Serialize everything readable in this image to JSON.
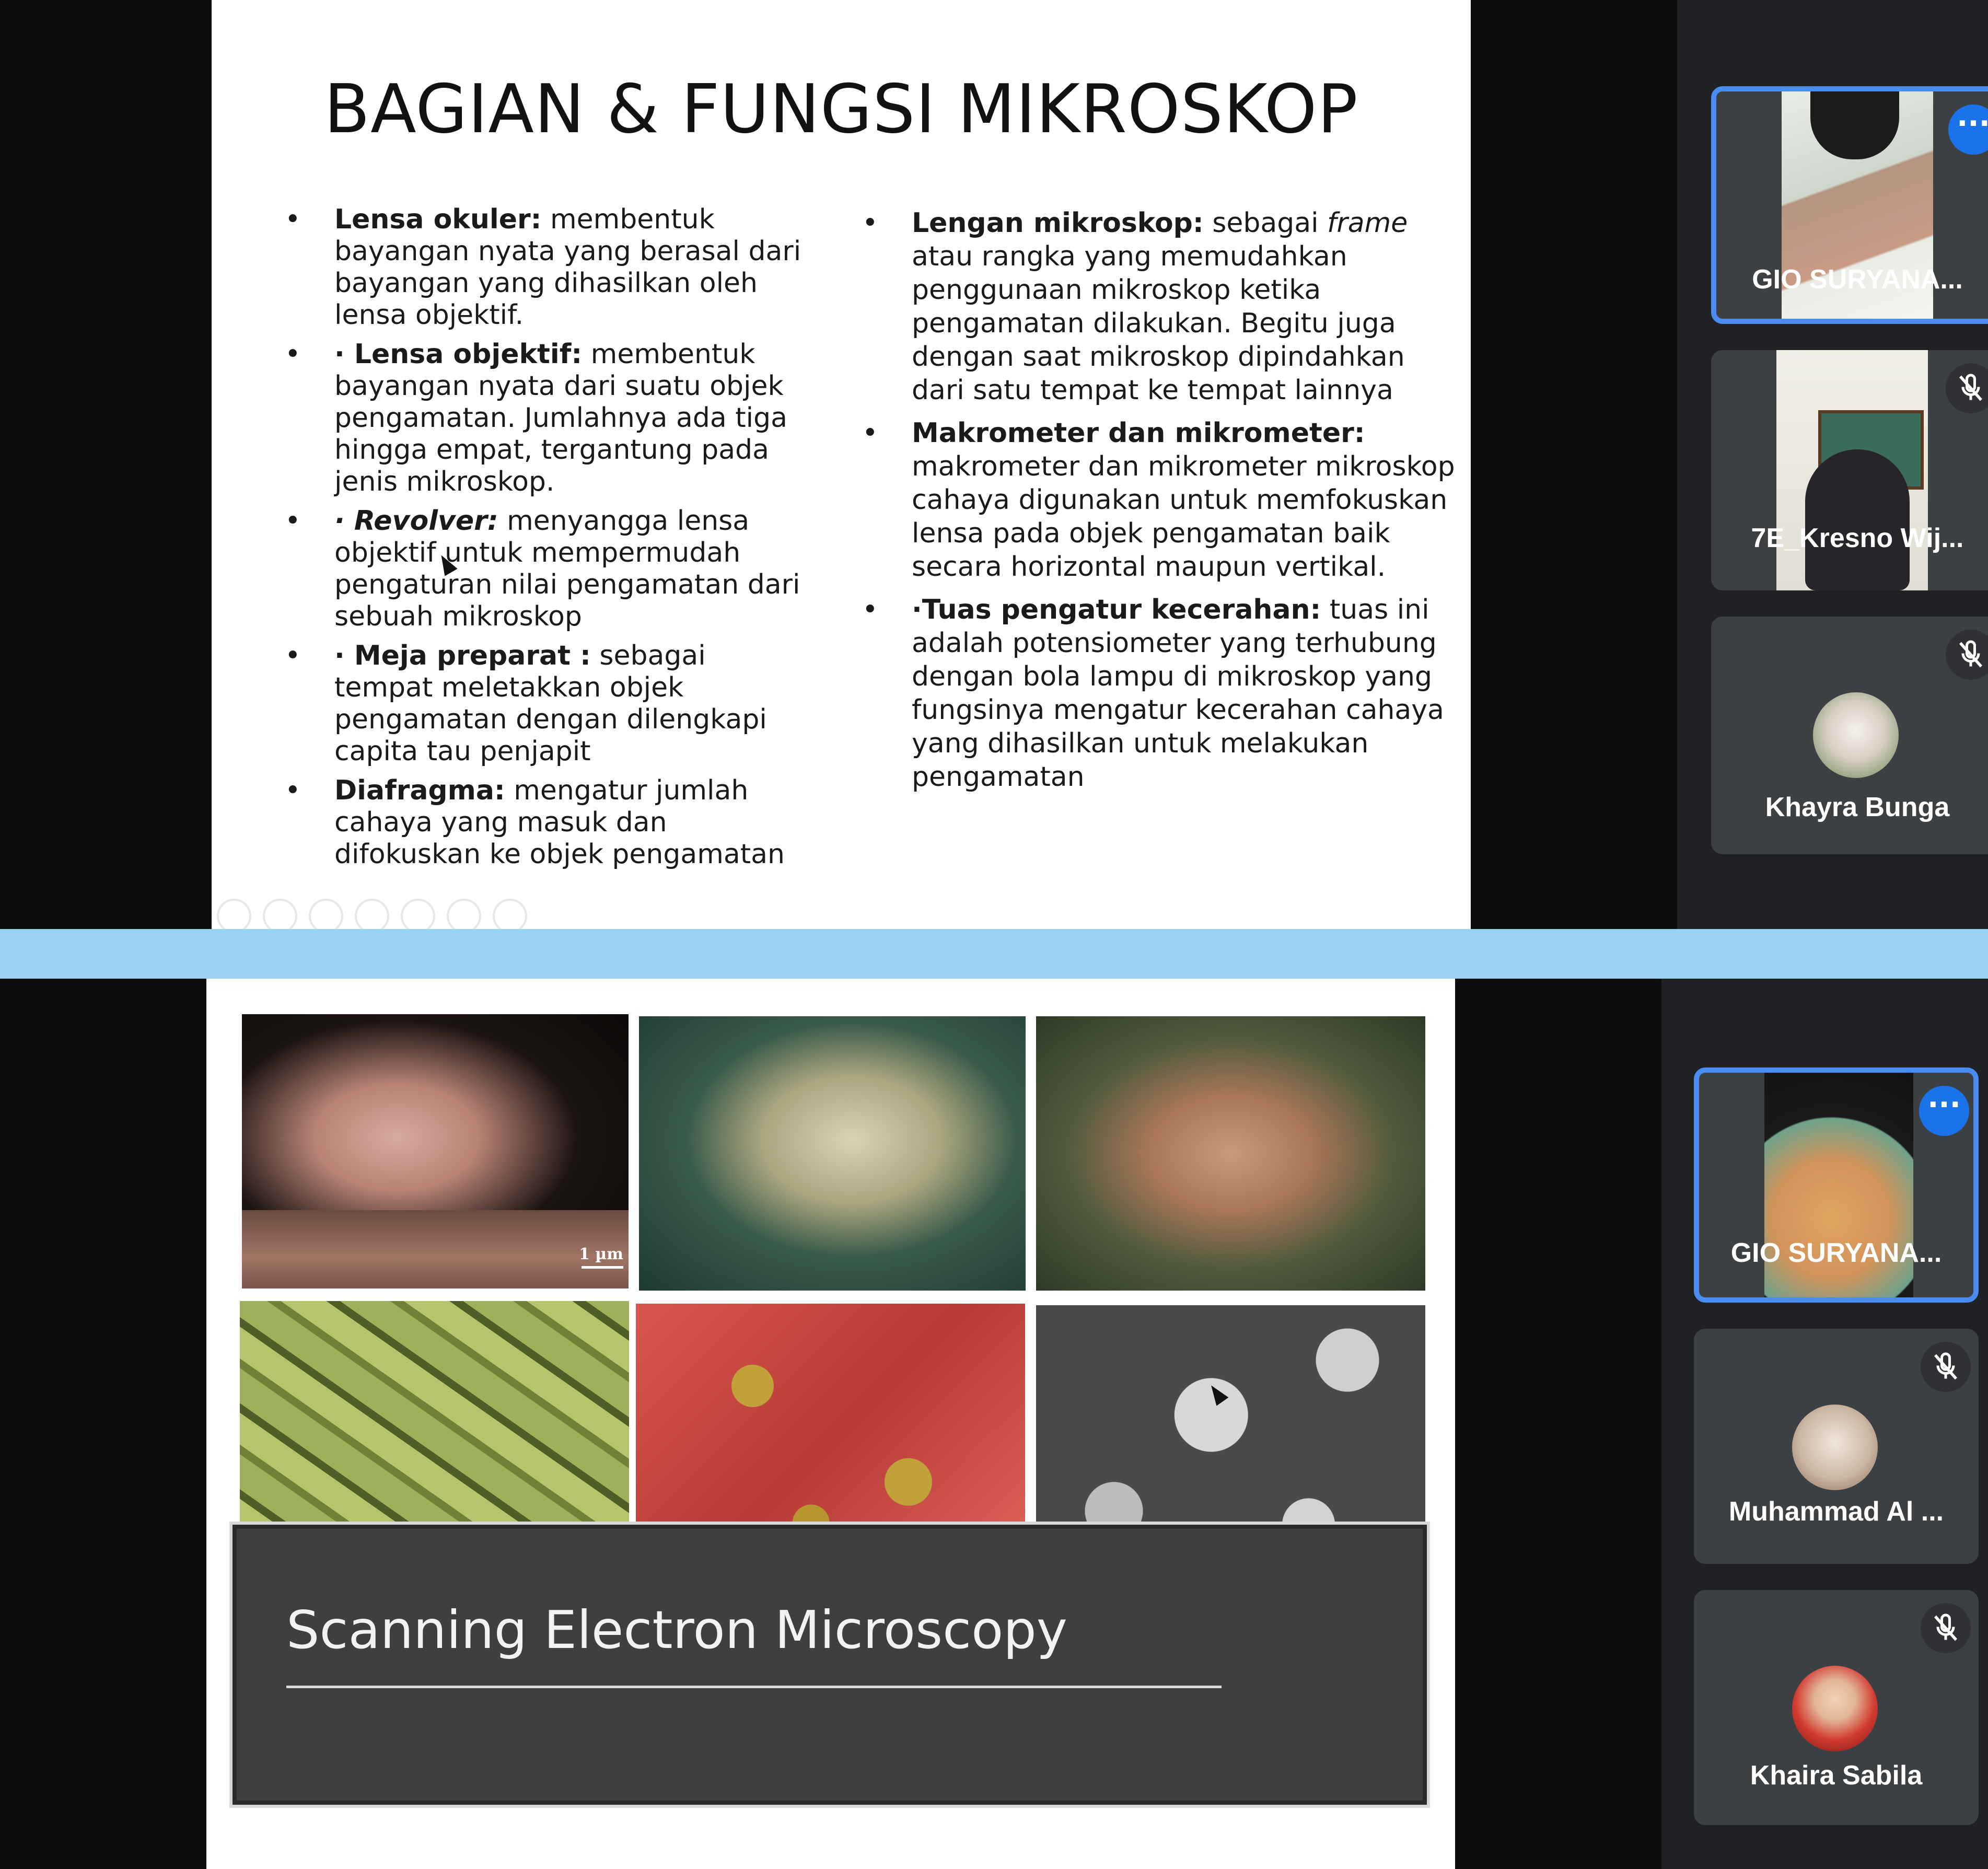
{
  "slide1": {
    "title": "BAGIAN & FUNGSI MIKROSKOP",
    "left_items": [
      {
        "term": "Lensa okuler:",
        "text": " membentuk bayangan nyata yang berasal dari bayangan yang dihasilkan oleh lensa objektif."
      },
      {
        "term": "· Lensa objektif:",
        "text": " membentuk bayangan nyata dari suatu objek pengamatan. Jumlahnya ada tiga hingga empat, tergantung pada jenis mikroskop."
      },
      {
        "term": "· Revolver:",
        "text": " menyangga lensa objektif untuk mempermudah pengaturan nilai pengamatan dari sebuah mikroskop"
      },
      {
        "term": "· Meja preparat :",
        "text": " sebagai tempat meletakkan objek pengamatan dengan dilengkapi capita tau penjapit"
      },
      {
        "term": "Diafragma:",
        "text": " mengatur jumlah cahaya yang masuk dan difokuskan ke objek pengamatan"
      }
    ],
    "right_items": [
      {
        "term": "Lengan mikroskop:",
        "text_a": " sebagai ",
        "italic": "frame",
        "text": " atau rangka yang memudahkan penggunaan mikroskop ketika pengamatan dilakukan. Begitu juga dengan saat mikroskop dipindahkan dari satu tempat ke tempat lainnya"
      },
      {
        "term": "Makrometer dan mikrometer:",
        "text": " makrometer dan mikrometer mikroskop cahaya digunakan untuk memfokuskan lensa pada objek pengamatan baik secara horizontal maupun vertikal."
      },
      {
        "term": "·Tuas pengatur kecerahan:",
        "text": " tuas ini adalah potensiometer yang terhubung dengan bola lampu di mikroskop yang fungsinya mengatur kecerahan cahaya yang dihasilkan untuk melakukan pengamatan"
      }
    ]
  },
  "participants_top": [
    {
      "name": "GIO SURYANA...",
      "state": "active",
      "icon": "more-options-icon"
    },
    {
      "name": "7E_Kresno Wij...",
      "state": "muted",
      "icon": "mic-off-icon"
    },
    {
      "name": "Khayra Bunga",
      "state": "muted",
      "icon": "mic-off-icon"
    }
  ],
  "slide2": {
    "scale_label": "1 µm",
    "banner_title": "Scanning Electron Microscopy"
  },
  "participants_bottom": [
    {
      "name": "GIO SURYANA...",
      "state": "active",
      "icon": "more-options-icon"
    },
    {
      "name": "Muhammad Al ...",
      "state": "muted",
      "icon": "mic-off-icon"
    },
    {
      "name": "Khaira Sabila",
      "state": "muted",
      "icon": "mic-off-icon"
    }
  ],
  "colors": {
    "accent_blue": "#1a73e8",
    "active_border": "#4a8cf0",
    "divider": "#9bd1f2",
    "tile_bg": "#3c4043"
  }
}
